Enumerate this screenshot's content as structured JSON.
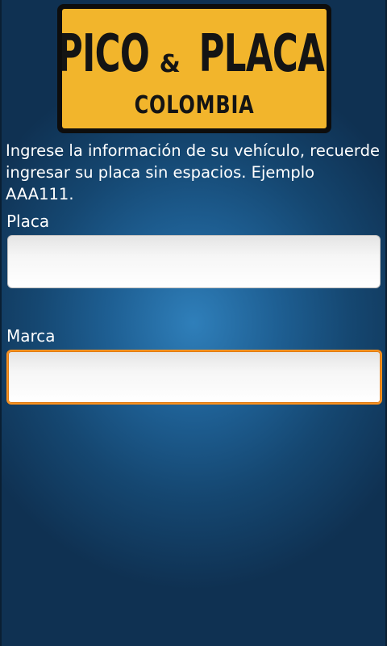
{
  "logo": {
    "title_left": "PICO",
    "title_amp": "&",
    "title_right": "PLACA",
    "subtitle": "COLOMBIA",
    "colors": {
      "plate": "#f2b52c",
      "frame": "#0d0d0d",
      "text": "#141414"
    }
  },
  "instructions": "Ingrese la información de su vehículo, recuerde ingresar su placa sin espacios. Ejemplo AAA111.",
  "form": {
    "placa": {
      "label": "Placa",
      "value": "",
      "placeholder": ""
    },
    "marca": {
      "label": "Marca",
      "value": "",
      "placeholder": "",
      "focused": true
    }
  },
  "colors": {
    "background": "#1e5f93",
    "focus_border": "#f7901e"
  }
}
